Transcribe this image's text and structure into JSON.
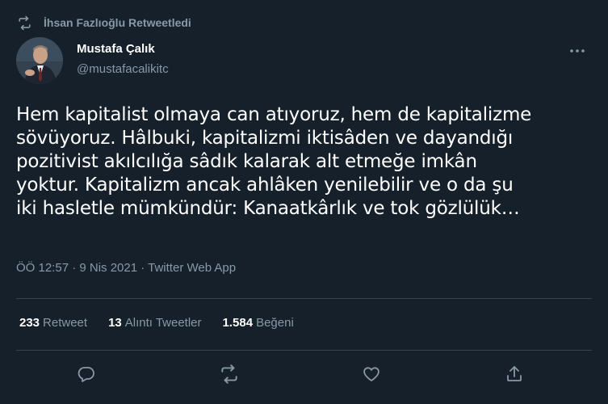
{
  "retweet_banner": {
    "text": "İhsan Fazlıoğlu Retweetledi",
    "icon": "retweet-icon"
  },
  "author": {
    "name": "Mustafa Çalık",
    "handle": "@mustafacalikitc",
    "avatar_icon": "avatar-photo"
  },
  "tweet": {
    "lines": [
      "Hem kapitalist olmaya can atıyoruz, hem de kapitalizme",
      "sövüyoruz. Hâlbuki, kapitalizmi iktisâden ve dayandığı",
      "pozitivist akılcılığa sâdık kalarak alt etmeğe imkân",
      "yoktur. Kapitalizm ancak ahlâken yenilebilir ve o da şu",
      "iki hasletle mümkündür: Kanaatkârlık ve tok gözlülük…"
    ],
    "meta": "ÖÖ 12:57 · 9 Nis 2021 · Twitter Web App"
  },
  "stats": {
    "retweets_count": "233",
    "retweets_label": "Retweet",
    "quotes_count": "13",
    "quotes_label": "Alıntı Tweetler",
    "likes_count": "1.584",
    "likes_label": "Beğeni"
  },
  "actions": {
    "reply_icon": "reply-icon",
    "retweet_icon": "retweet-icon",
    "like_icon": "heart-icon",
    "share_icon": "share-icon"
  },
  "colors": {
    "background": "#15202b",
    "secondary_text": "#8899a6",
    "divider": "#38444d"
  }
}
